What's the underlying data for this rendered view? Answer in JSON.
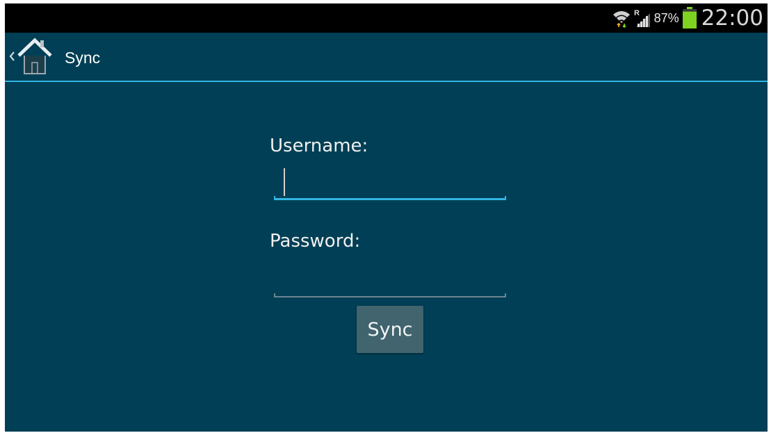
{
  "status_bar": {
    "wifi_icon": "wifi-icon",
    "roaming_indicator": "R",
    "signal_icon": "signal-icon",
    "battery_percent": "87%",
    "battery_level": 0.87,
    "battery_icon": "battery-icon",
    "time": "22:00"
  },
  "action_bar": {
    "up_icon": "chevron-left-icon",
    "home_icon": "home-icon",
    "title": "Sync",
    "divider_color": "#33b5e5"
  },
  "form": {
    "username_label": "Username:",
    "username_value": "",
    "password_label": "Password:",
    "password_value": "",
    "submit_label": "Sync"
  },
  "colors": {
    "background": "#003f55",
    "accent": "#33b5e5",
    "button": "#41646f",
    "battery_green": "#7ed321"
  }
}
